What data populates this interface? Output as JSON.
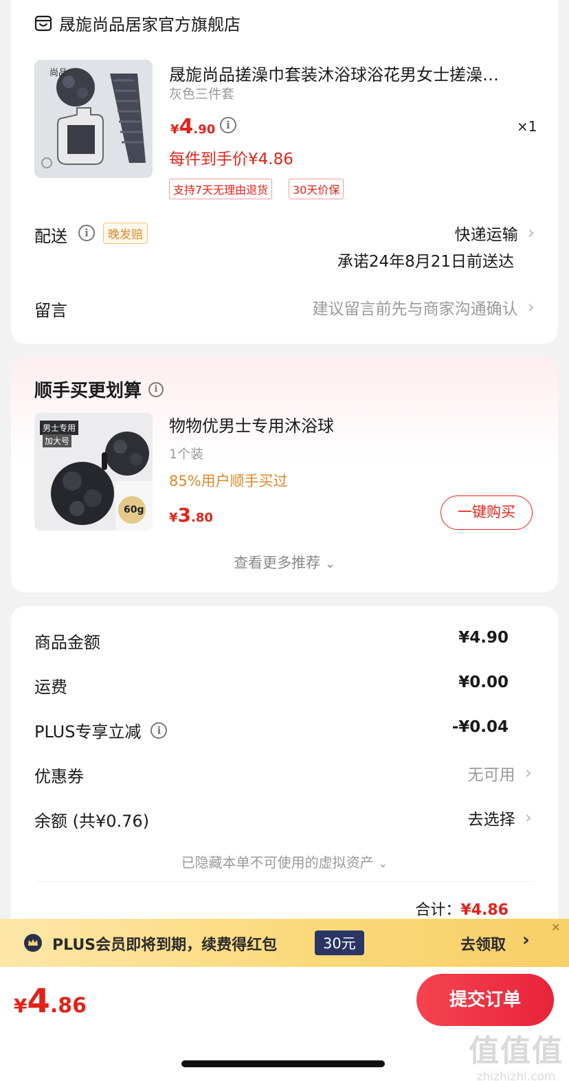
{
  "store": {
    "name": "晟旎尚品居家官方旗舰店",
    "product": {
      "thumb_text": "尚品",
      "title": "晟旎尚品搓澡巾套装沐浴球浴花男女士搓澡…",
      "variant": "灰色三件套",
      "price_symbol": "¥",
      "price_int": "4",
      "price_dec": ".90",
      "qty": "×1",
      "final_price": "每件到手价¥4.86",
      "tags": [
        "支持7天无理由退货",
        "30天价保"
      ]
    },
    "delivery": {
      "label": "配送",
      "badge": "晚发赔",
      "method": "快递运输",
      "promise": "承诺24年8月21日前送达"
    },
    "message": {
      "label": "留言",
      "placeholder": "建议留言前先与商家沟通确认"
    }
  },
  "recommend": {
    "title": "顺手买更划算",
    "item": {
      "thumb_tag": "男士专用",
      "thumb_sub": "加大号",
      "thumb_weight": "60g",
      "name": "物物优男士专用沐浴球",
      "spec": "1个装",
      "social": "85%用户顺手买过",
      "price_symbol": "¥",
      "price_int": "3",
      "price_dec": ".80",
      "button": "一键购买"
    },
    "more": "查看更多推荐"
  },
  "summary": {
    "rows": [
      {
        "label": "商品金额",
        "value": "¥4.90"
      },
      {
        "label": "运费",
        "value": "¥0.00"
      },
      {
        "label": "PLUS专享立减",
        "value": "-¥0.04"
      },
      {
        "label": "优惠券",
        "value": "无可用"
      },
      {
        "label": "余额 (共¥0.76)",
        "value": "去选择"
      }
    ],
    "hidden_note": "已隐藏本单不可使用的虚拟资产",
    "total_label": "合计：",
    "total_value": "¥4.86"
  },
  "plus_bar": {
    "text": "PLUS会员即将到期，续费得红包",
    "badge": "30元",
    "action": "去领取"
  },
  "bottom": {
    "price_symbol": "¥",
    "price_int": "4",
    "price_dec": ".86",
    "submit": "提交订单"
  },
  "watermark": {
    "logo": "值值值",
    "url": "zhizhizhi.com"
  },
  "colors": {
    "accent_red": "#e2231a",
    "orange": "#d9892a",
    "plus_bar": "#fbd97a"
  }
}
